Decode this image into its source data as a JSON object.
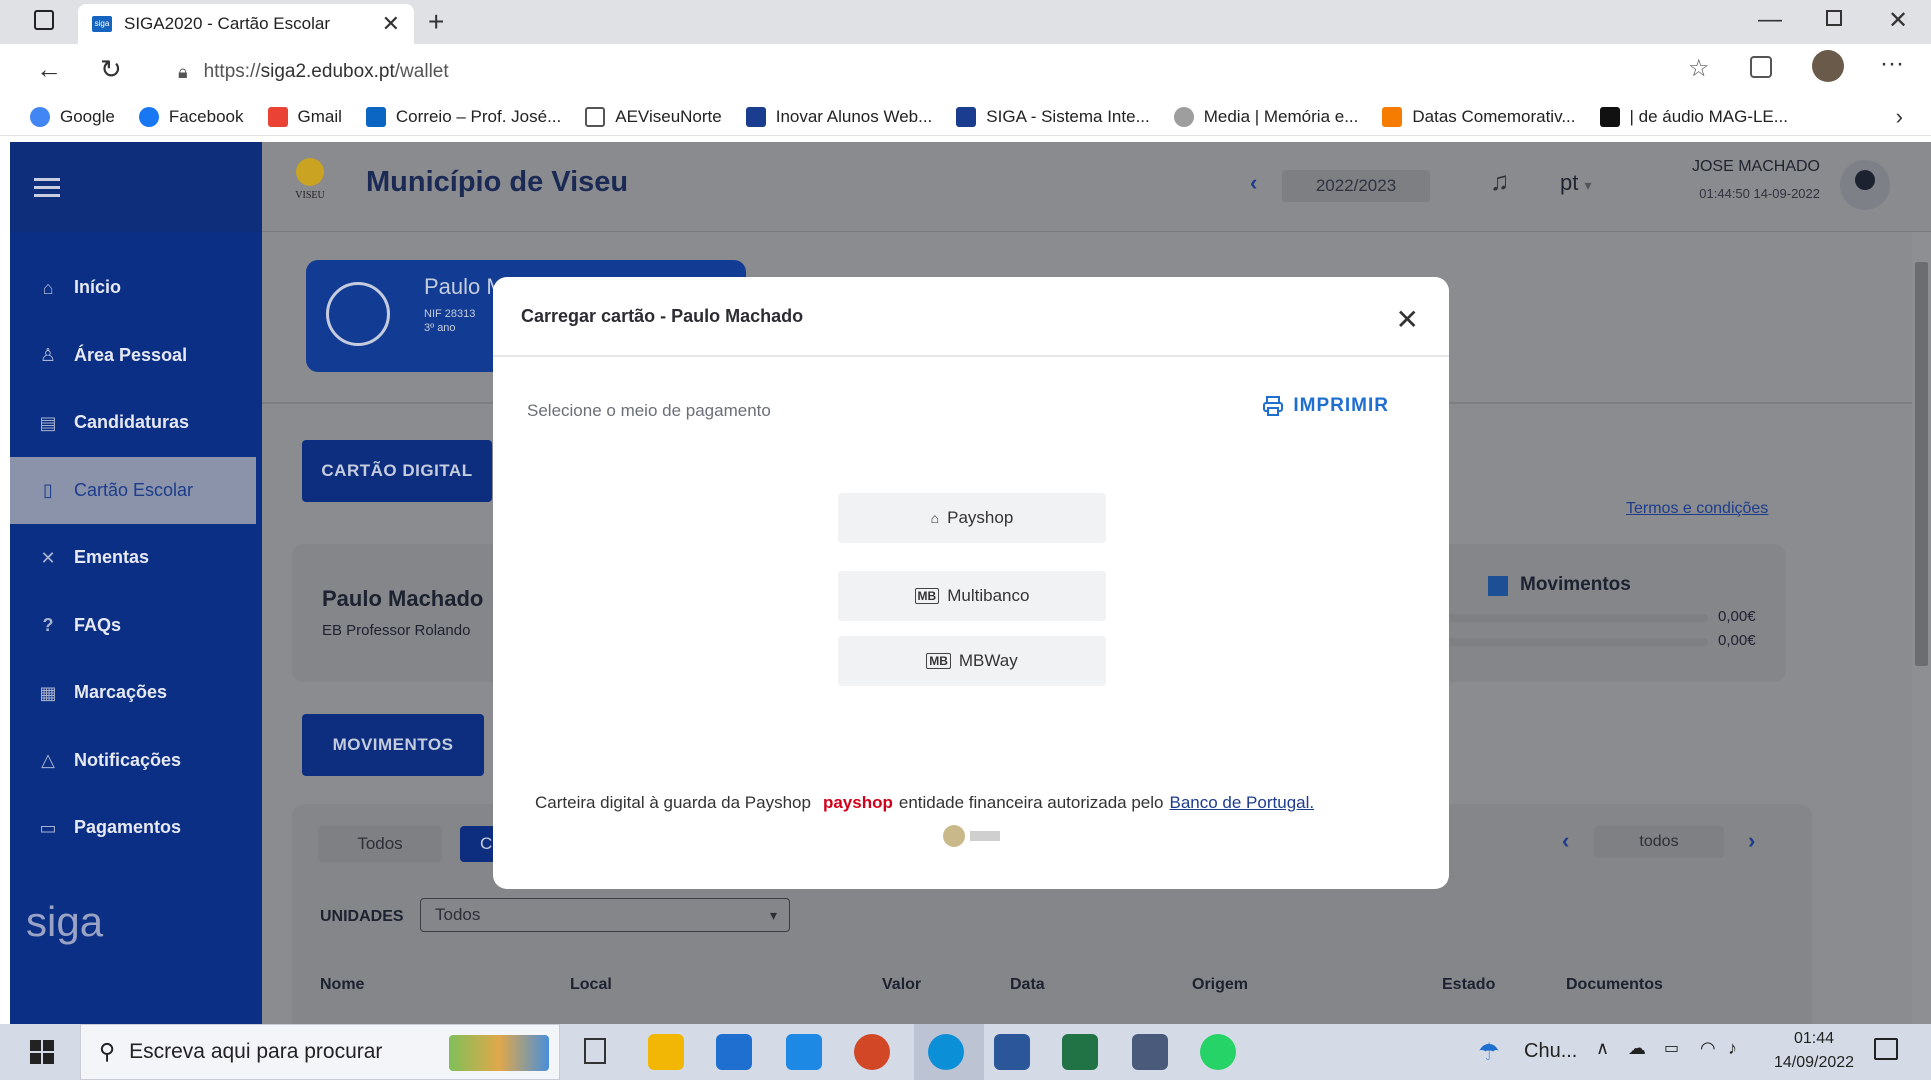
{
  "browser": {
    "tab_title": "SIGA2020 - Cartão Escolar",
    "url_prefix": "https://",
    "url_host": "siga2.edubox.pt",
    "url_path": "/wallet",
    "bookmarks": [
      {
        "label": "Google",
        "color": "#4285f4"
      },
      {
        "label": "Facebook",
        "color": "#1877f2"
      },
      {
        "label": "Gmail",
        "color": "#ea4335"
      },
      {
        "label": "Correio – Prof. José...",
        "color": "#0a66c2"
      },
      {
        "label": "AEViseuNorte",
        "color": "#777777"
      },
      {
        "label": "Inovar Alunos Web...",
        "color": "#1a3d8f"
      },
      {
        "label": "SIGA - Sistema Inte...",
        "color": "#1a3d8f"
      },
      {
        "label": "Media | Memória e...",
        "color": "#8e8e8e"
      },
      {
        "label": "Datas Comemorativ...",
        "color": "#f57c00"
      },
      {
        "label": "| de áudio MAG-LE...",
        "color": "#111111"
      }
    ]
  },
  "app": {
    "logo_text": "siga",
    "municipality": "Município de Viseu",
    "school_year": "2022/2023",
    "language": "pt",
    "user_name": "JOSE MACHADO",
    "user_time": "01:44:50 14-09-2022",
    "nav": [
      {
        "label": "Início",
        "icon": "⌂"
      },
      {
        "label": "Área Pessoal",
        "icon": "♙"
      },
      {
        "label": "Candidaturas",
        "icon": "▤"
      },
      {
        "label": "Cartão Escolar",
        "icon": "▯"
      },
      {
        "label": "Ementas",
        "icon": "✕"
      },
      {
        "label": "FAQs",
        "icon": "?"
      },
      {
        "label": "Marcações",
        "icon": "▦"
      },
      {
        "label": "Notificações",
        "icon": "♫"
      },
      {
        "label": "Pagamentos",
        "icon": "▭"
      }
    ],
    "student_card": {
      "name": "Paulo M",
      "nif": "NIF 28313",
      "grade": "3º ano"
    },
    "btn_digital_card": "CARTÃO DIGITAL",
    "terms_link": "Termos e condições",
    "wallet_owner": "Paulo Machado",
    "wallet_school": "EB Professor Rolando",
    "movements_title": "Movimentos",
    "movement_values": [
      "0,00€",
      "0,00€"
    ],
    "btn_movements": "MOVIMENTOS",
    "filter_all": "Todos",
    "filter_c": "C",
    "pager_value": "todos",
    "units_label": "UNIDADES",
    "units_value": "Todos",
    "table_headers": [
      "Nome",
      "Local",
      "Valor",
      "Data",
      "Origem",
      "Estado",
      "Documentos"
    ]
  },
  "modal": {
    "title": "Carregar cartão - Paulo Machado",
    "select_label": "Selecione o meio de pagamento",
    "print_label": "IMPRIMIR",
    "payment_options": [
      {
        "label": "Payshop",
        "icon": "⌂"
      },
      {
        "label": "Multibanco",
        "icon": "MB"
      },
      {
        "label": "MBWay",
        "icon": "MB"
      }
    ],
    "footer_prefix": "Carteira digital à guarda da Payshop",
    "footer_brand": "payshop",
    "footer_middle": "entidade financeira autorizada pelo",
    "footer_link": "Banco de Portugal."
  },
  "taskbar": {
    "search_placeholder": "Escreva aqui para procurar",
    "weather": "Chu...",
    "time": "01:44",
    "date": "14/09/2022"
  }
}
